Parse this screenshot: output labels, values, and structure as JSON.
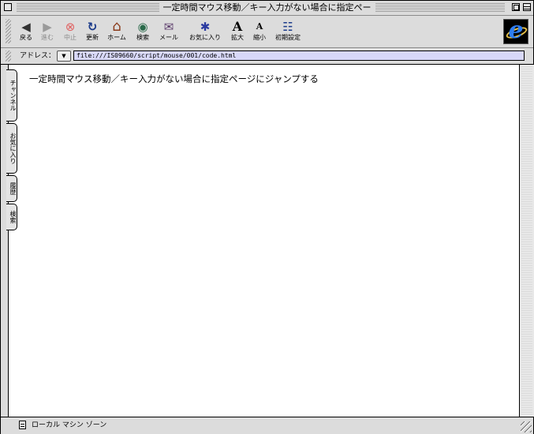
{
  "window": {
    "title": "一定時間マウス移動／キー入力がない場合に指定ペー"
  },
  "toolbar": {
    "buttons": [
      {
        "label": "戻る",
        "icon": "back-arrow-icon",
        "glyph": "◀",
        "enabled": true
      },
      {
        "label": "進む",
        "icon": "forward-arrow-icon",
        "glyph": "▶",
        "enabled": false
      },
      {
        "label": "中止",
        "icon": "stop-icon",
        "glyph": "⊗",
        "enabled": false
      },
      {
        "label": "更新",
        "icon": "refresh-icon",
        "glyph": "↻",
        "enabled": true
      },
      {
        "label": "ホーム",
        "icon": "home-icon",
        "glyph": "⌂",
        "enabled": true
      },
      {
        "label": "検索",
        "icon": "search-icon",
        "glyph": "◉",
        "enabled": true
      },
      {
        "label": "メール",
        "icon": "mail-icon",
        "glyph": "✉",
        "enabled": true
      },
      {
        "label": "お気に入り",
        "icon": "favorites-icon",
        "glyph": "✱",
        "enabled": true
      },
      {
        "label": "拡大",
        "icon": "text-larger-icon",
        "glyph": "A",
        "enabled": true
      },
      {
        "label": "縮小",
        "icon": "text-smaller-icon",
        "glyph": "A",
        "enabled": true
      },
      {
        "label": "初期設定",
        "icon": "preferences-icon",
        "glyph": "☷",
        "enabled": true
      }
    ]
  },
  "address": {
    "label": "アドレス：",
    "url": "file:///IS09660/script/mouse/001/code.html"
  },
  "sidetabs": [
    "チャンネル",
    "お気に入り",
    "履歴",
    "検索"
  ],
  "content": {
    "text": "一定時間マウス移動／キー入力がない場合に指定ページにジャンプする"
  },
  "status": {
    "text": "ローカル マシン ゾーン"
  },
  "colors": {
    "chrome": "#dcdcdc",
    "address_field": "#d8d8f8",
    "ie_blue": "#2f7ef0"
  }
}
